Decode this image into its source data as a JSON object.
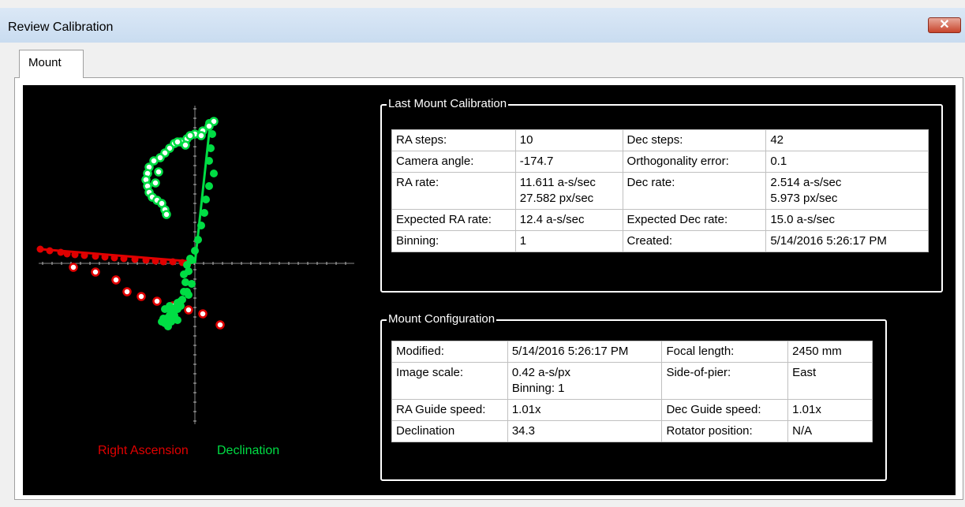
{
  "window": {
    "title": "Review Calibration",
    "close_glyph": "✕"
  },
  "tabs": [
    {
      "label": "Mount"
    }
  ],
  "legend": {
    "ra": "Right Ascension",
    "dec": "Declination",
    "ra_color": "#e00000",
    "dec_color": "#00dd44"
  },
  "last_mount_calibration": {
    "title": "Last Mount Calibration",
    "rows": [
      [
        "RA steps:",
        "10",
        "Dec steps:",
        "42"
      ],
      [
        "Camera angle:",
        "-174.7",
        "Orthogonality error:",
        "0.1"
      ],
      [
        "RA rate:",
        "11.611 a-s/sec\n27.582 px/sec",
        "Dec rate:",
        "2.514 a-s/sec\n5.973 px/sec"
      ],
      [
        "Expected RA rate:",
        "12.4 a-s/sec",
        "Expected Dec rate:",
        "15.0 a-s/sec"
      ],
      [
        "Binning:",
        "1",
        "Created:",
        "5/14/2016 5:26:17 PM"
      ]
    ]
  },
  "mount_configuration": {
    "title": "Mount Configuration",
    "rows": [
      [
        "Modified:",
        "5/14/2016 5:26:17 PM",
        "Focal length:",
        "2450 mm"
      ],
      [
        "Image scale:",
        "0.42 a-s/px\nBinning: 1",
        "Side-of-pier:",
        "East"
      ],
      [
        "RA Guide speed:",
        "1.01x",
        "Dec Guide speed:",
        "1.01x"
      ],
      [
        "Declination",
        "34.3",
        "Rotator position:",
        "N/A"
      ]
    ]
  }
}
